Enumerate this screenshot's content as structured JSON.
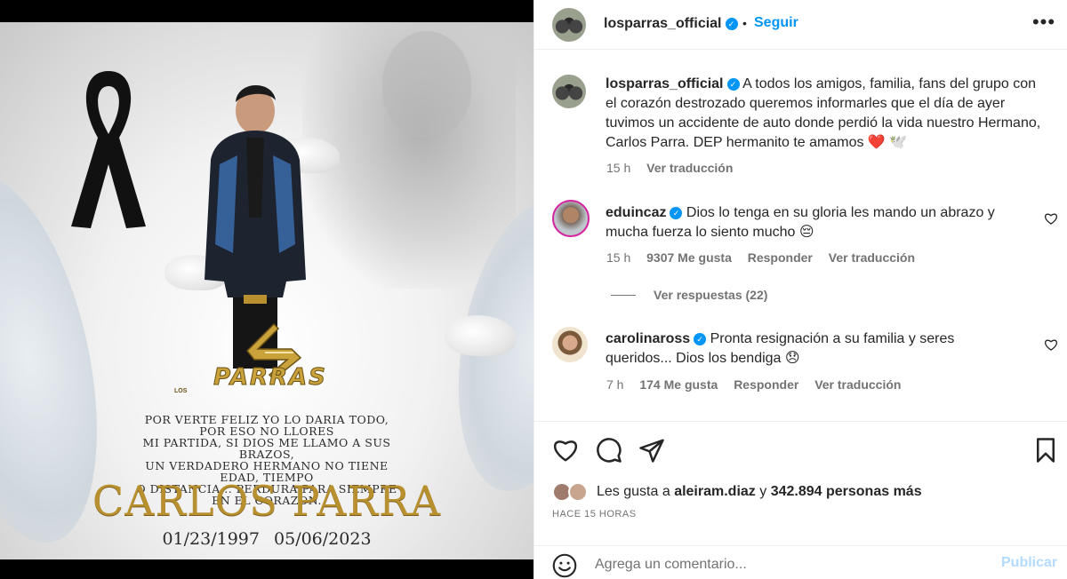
{
  "post_image": {
    "logo_small": "LOS",
    "logo_text": "PARRAS",
    "epitaph_lines": [
      "POR VERTE FELIZ YO LO DARIA TODO,",
      "POR ESO NO LLORES",
      "MI PARTIDA, SI DIOS ME LLAMO A SUS BRAZOS,",
      "UN VERDADERO HERMANO NO TIENE EDAD, TIEMPO",
      "O DISTANCIA... PERDURA PARA SIEMPRE EN EL CORAZON."
    ],
    "name": "CARLOS PARRA",
    "dates": "01/23/1997 05/06/2023",
    "colors": {
      "gold": "#b8902f",
      "ribbon": "#111111"
    }
  },
  "header": {
    "username": "losparras_official",
    "separator": "•",
    "follow_label": "Seguir",
    "more_icon": "more-horizontal-icon"
  },
  "caption": {
    "username": "losparras_official",
    "text": "A todos los amigos, familia, fans del grupo con el corazón destrozado queremos informarles que el día de ayer tuvimos un accidente de auto donde perdió la vida nuestro Hermano, Carlos Parra. DEP hermanito te amamos ❤️ 🕊️",
    "time": "15 h",
    "translate": "Ver traducción"
  },
  "comments": [
    {
      "username": "eduincaz",
      "text": "Dios lo tenga en su gloria les mando un abrazo y mucha fuerza lo siento mucho 😔",
      "time": "15 h",
      "likes": "9307 Me gusta",
      "reply": "Responder",
      "translate": "Ver traducción",
      "replies": "Ver respuestas (22)"
    },
    {
      "username": "carolinaross",
      "text": "Pronta resignación a su familia y seres queridos... Dios los bendiga 😞",
      "time": "7 h",
      "likes": "174 Me gusta",
      "reply": "Responder",
      "translate": "Ver traducción"
    }
  ],
  "likes": {
    "prefix": "Les gusta a",
    "user": "aleiram.diaz",
    "connector": "y",
    "count": "342.894 personas más"
  },
  "time_ago": "HACE 15 HORAS",
  "composer": {
    "placeholder": "Agrega un comentario...",
    "publish_label": "Publicar"
  }
}
